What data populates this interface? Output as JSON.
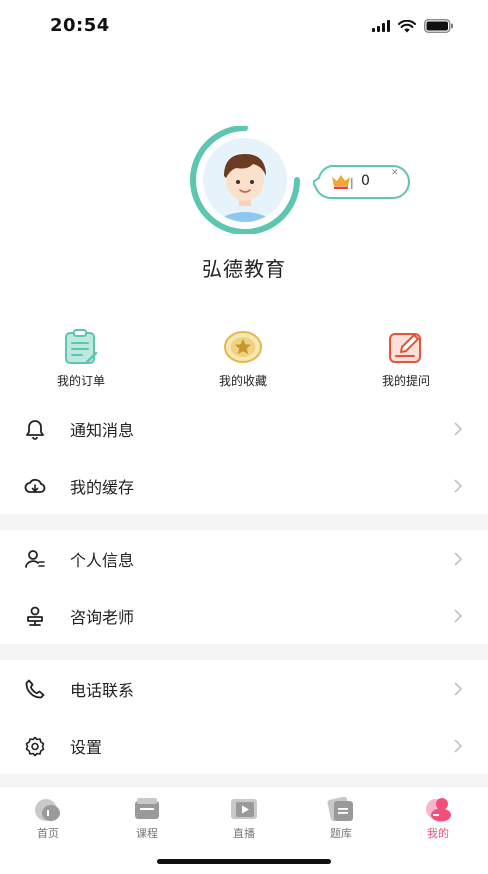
{
  "status_bar": {
    "time": "20:54"
  },
  "profile": {
    "name": "弘德教育",
    "vip_count": "0"
  },
  "quick_actions": [
    {
      "label": "我的订单",
      "icon": "order-clipboard-icon"
    },
    {
      "label": "我的收藏",
      "icon": "favorite-star-icon"
    },
    {
      "label": "我的提问",
      "icon": "question-edit-icon"
    }
  ],
  "menu": {
    "notifications": "通知消息",
    "cache": "我的缓存",
    "personal_info": "个人信息",
    "consult_teacher": "咨询老师",
    "phone_contact": "电话联系",
    "settings": "设置"
  },
  "tabs": [
    {
      "label": "首页",
      "icon": "home-icon"
    },
    {
      "label": "课程",
      "icon": "course-icon"
    },
    {
      "label": "直播",
      "icon": "live-icon"
    },
    {
      "label": "题库",
      "icon": "question-bank-icon"
    },
    {
      "label": "我的",
      "icon": "profile-icon",
      "active": true
    }
  ],
  "colors": {
    "accent_teal": "#5cc6b0",
    "tab_active": "#f0507a",
    "favorite_gold": "#e2b84a",
    "question_red": "#e2553d"
  }
}
